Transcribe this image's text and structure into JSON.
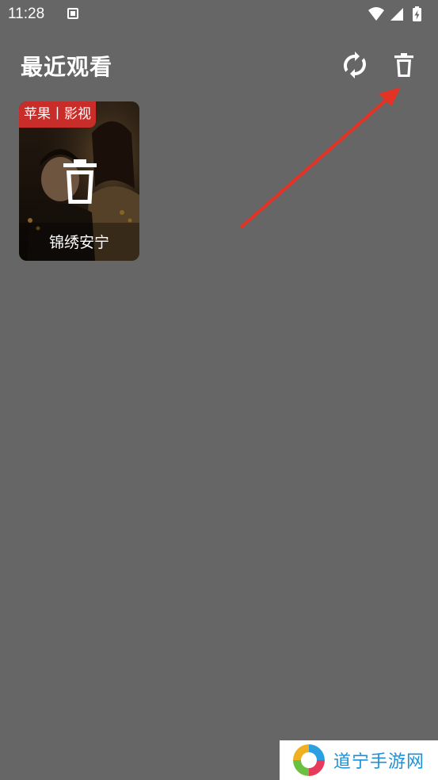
{
  "status_bar": {
    "time": "11:28",
    "notification_icon": "a-box-icon",
    "icons": [
      "wifi-icon",
      "signal-icon",
      "battery-charging-icon"
    ]
  },
  "header": {
    "title": "最近观看",
    "refresh_icon": "refresh-icon",
    "delete_icon": "trash-icon"
  },
  "history": {
    "items": [
      {
        "source_badge": "苹果丨影视",
        "title": "锦绣安宁",
        "overlay_icon": "trash-icon"
      }
    ]
  },
  "annotation": {
    "arrow_color": "#e53224",
    "arrow_target": "delete-button"
  },
  "watermark": {
    "text": "道宁手游网"
  },
  "colors": {
    "background": "#666666",
    "badge": "#c92d2a",
    "watermark_text": "#1f8fd6"
  }
}
